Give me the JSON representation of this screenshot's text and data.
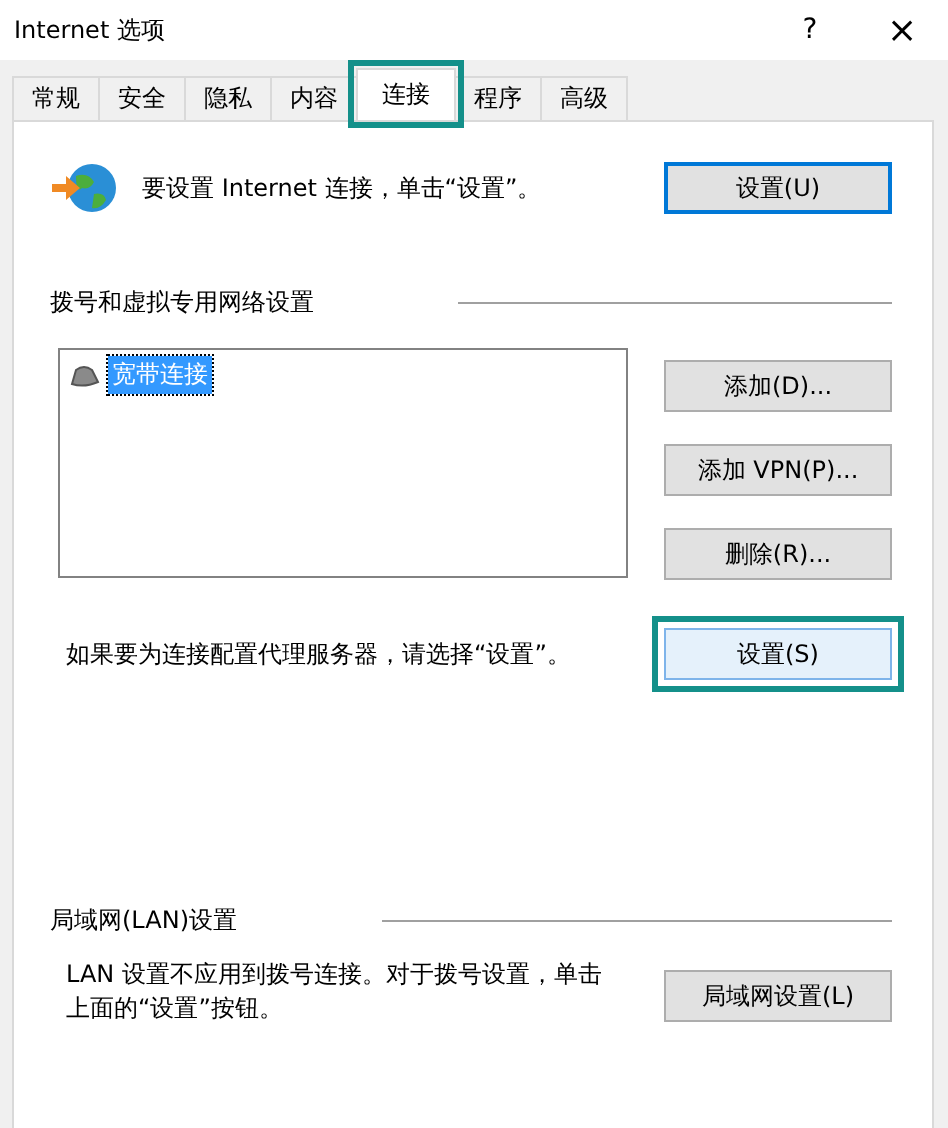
{
  "window": {
    "title": "Internet 选项",
    "help": "?",
    "close": "×"
  },
  "tabs": [
    {
      "label": "常规",
      "selected": false,
      "highlighted": false
    },
    {
      "label": "安全",
      "selected": false,
      "highlighted": false
    },
    {
      "label": "隐私",
      "selected": false,
      "highlighted": false
    },
    {
      "label": "内容",
      "selected": false,
      "highlighted": false
    },
    {
      "label": "连接",
      "selected": true,
      "highlighted": true
    },
    {
      "label": "程序",
      "selected": false,
      "highlighted": false
    },
    {
      "label": "高级",
      "selected": false,
      "highlighted": false
    }
  ],
  "setup": {
    "text": "要设置 Internet 连接，单击“设置”。",
    "button": {
      "label": "设置(U)",
      "focused": true
    }
  },
  "dialup": {
    "heading": "拨号和虚拟专用网络设置",
    "connections": [
      {
        "name": "宽带连接",
        "selected": true
      }
    ],
    "buttons": [
      {
        "label": "添加(D)..."
      },
      {
        "label": "添加 VPN(P)..."
      },
      {
        "label": "删除(R)..."
      }
    ],
    "proxy_text": "如果要为连接配置代理服务器，请选择“设置”。",
    "proxy_button": {
      "label": "设置(S)",
      "highlighted": true
    }
  },
  "lan": {
    "heading": "局域网(LAN)设置",
    "text": "LAN 设置不应用到拨号连接。对于拨号设置，单击上面的“设置”按钮。",
    "button": {
      "label": "局域网设置(L)"
    }
  }
}
